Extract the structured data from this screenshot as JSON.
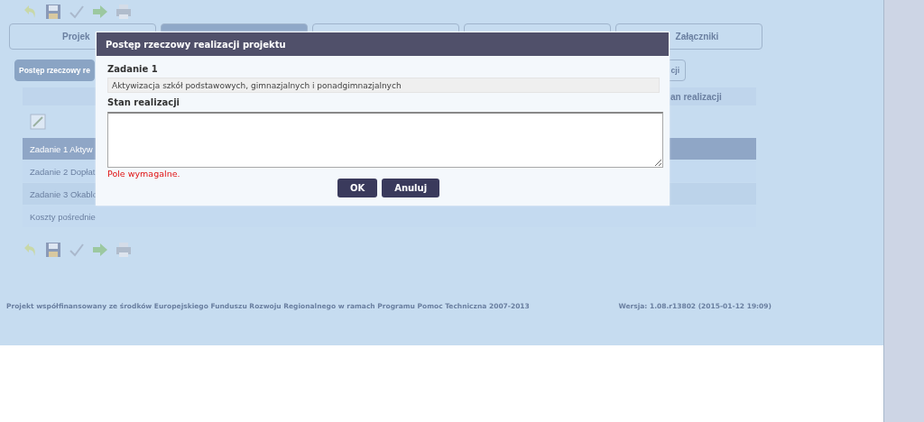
{
  "tabs": [
    {
      "label": "Projek",
      "selected": false
    },
    {
      "selected": true
    },
    {
      "selected": false
    },
    {
      "selected": false
    },
    {
      "label": "Załączniki",
      "selected": false
    }
  ],
  "subtabs": [
    {
      "label": "Postęp rzeczowy re",
      "selected": true
    },
    {
      "label": "cji",
      "selected": false
    }
  ],
  "table": {
    "header": "an realizacji",
    "rows": [
      {
        "label": "Zadanie 1 Aktyw",
        "selected": true
      },
      {
        "label": "Zadanie 2 Dopłat",
        "selected": false
      },
      {
        "label": "Zadanie 3 Okablo",
        "selected": false
      },
      {
        "label": "Koszty pośrednie",
        "selected": false
      }
    ]
  },
  "footer": {
    "note": "Projekt współfinansowany ze środków Europejskiego Funduszu Rozwoju Regionalnego w ramach Programu Pomoc Techniczna 2007-2013",
    "version": "Wersja: 1.08.r13802 (2015-01-12 19:09)"
  },
  "dialog": {
    "title": "Postęp rzeczowy realizacji projektu",
    "task_label": "Zadanie 1",
    "task_value": "Aktywizacja szkół podstawowych, gimnazjalnych i ponadgimnazjalnych",
    "status_label": "Stan realizacji",
    "error": "Pole wymagalne.",
    "buttons": [
      "OK",
      "Anuluj"
    ]
  }
}
